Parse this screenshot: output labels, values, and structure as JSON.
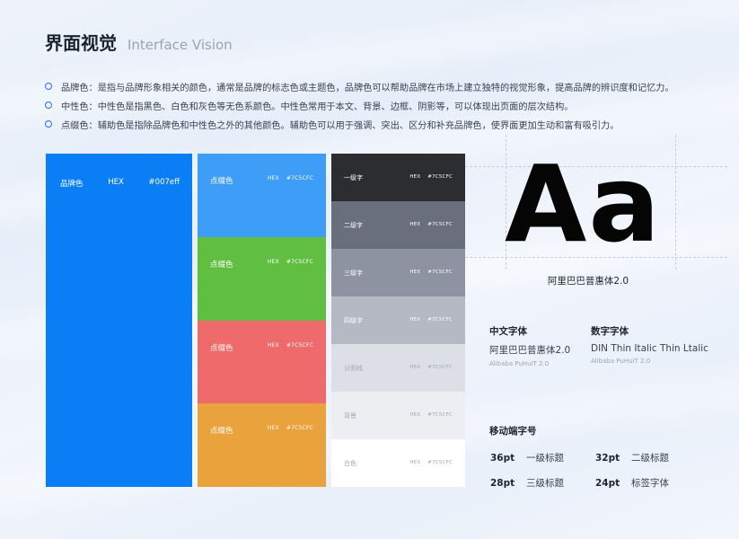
{
  "header": {
    "title_cn": "界面视觉",
    "title_en": "Interface Vision"
  },
  "bullets": [
    {
      "text": "品牌色：是指与品牌形象相关的颜色，通常是品牌的标志色或主题色，品牌色可以帮助品牌在市场上建立独特的视觉形象，提高品牌的辨识度和记忆力。"
    },
    {
      "text": "中性色：中性色是指黑色、白色和灰色等无色系颜色。中性色常用于本文、背景、边框、阴影等，可以体现出页面的层次结构。"
    },
    {
      "text": "点缀色：辅助色是指除品牌色和中性色之外的其他颜色。辅助色可以用于强调、突出、区分和补充品牌色，使界面更加生动和富有吸引力。"
    }
  ],
  "colors": {
    "bullet_accent": "#2b6cff",
    "brand": {
      "label": "品牌色",
      "hex_label": "HEX",
      "hex_value": "#007eff",
      "fill": "#0a7ff5"
    },
    "accents": [
      {
        "label": "点缀色",
        "hex_label": "HEX",
        "hex_value": "#7C5CFC",
        "fill": "#3d9df7"
      },
      {
        "label": "点缀色",
        "hex_label": "HEX",
        "hex_value": "#7C5CFC",
        "fill": "#60be41"
      },
      {
        "label": "点缀色",
        "hex_label": "HEX",
        "hex_value": "#7C5CFC",
        "fill": "#ef6a6a"
      },
      {
        "label": "点缀色",
        "hex_label": "HEX",
        "hex_value": "#7C5CFC",
        "fill": "#eaa23d"
      }
    ],
    "neutrals": [
      {
        "label": "一级字",
        "hex_label": "HEX",
        "hex_value": "#7C5CFC",
        "fill": "#2b2d31",
        "text": "#ffffff"
      },
      {
        "label": "二级字",
        "hex_label": "HEX",
        "hex_value": "#7C5CFC",
        "fill": "#696f7c",
        "text": "#ffffff"
      },
      {
        "label": "三级字",
        "hex_label": "HEX",
        "hex_value": "#7C5CFC",
        "fill": "#8d93a0",
        "text": "#ffffff"
      },
      {
        "label": "四级字",
        "hex_label": "HEX",
        "hex_value": "#7C5CFC",
        "fill": "#b4b9c4",
        "text": "#ffffff"
      },
      {
        "label": "分割线",
        "hex_label": "HEX",
        "hex_value": "#7C5CFC",
        "fill": "#dcdfe5",
        "text": "#a0a6b2"
      },
      {
        "label": "背景",
        "hex_label": "HEX",
        "hex_value": "#7C5CFC",
        "fill": "#eceef2",
        "text": "#a0a6b2"
      },
      {
        "label": "白色",
        "hex_label": "HEX",
        "hex_value": "#7C5CFC",
        "fill": "#ffffff",
        "text": "#a0a6b2"
      }
    ]
  },
  "typography": {
    "sample": "Aa",
    "sample_caption": "阿里巴巴普惠体2.0",
    "chinese": {
      "heading": "中文字体",
      "name": "阿里巴巴普惠体2.0",
      "sub": "Alibaba PuHuiT 2.0"
    },
    "numeric": {
      "heading": "数字字体",
      "name": "DIN Thin Italic Thin Ltalic",
      "sub": "Alibaba PuHuiT 2.0"
    }
  },
  "mobile_sizes": {
    "title": "移动端字号",
    "items": [
      {
        "pt": "36pt",
        "label": "一级标题"
      },
      {
        "pt": "32pt",
        "label": "二级标题"
      },
      {
        "pt": "28pt",
        "label": "三级标题"
      },
      {
        "pt": "24pt",
        "label": "标签字体"
      }
    ]
  }
}
